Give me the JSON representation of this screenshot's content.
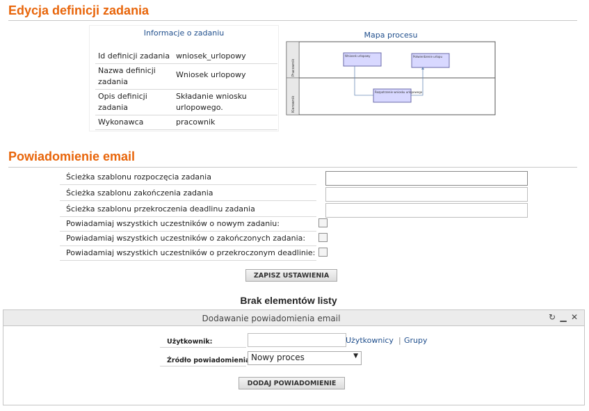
{
  "page": {
    "title": "Edycja definicji zadania"
  },
  "task_info": {
    "header": "Informacje o zadaniu",
    "rows": [
      {
        "key": "Id definicji zadania",
        "value": "wniosek_urlopowy"
      },
      {
        "key": "Nazwa definicji zadania",
        "value": "Wniosek urlopowy"
      },
      {
        "key": "Opis definicji zadania",
        "value": "Składanie wniosku urlopowego."
      },
      {
        "key": "Wykonawca",
        "value": "pracownik"
      }
    ]
  },
  "process_map": {
    "header": "Mapa procesu",
    "lane_top": "Pracownik",
    "lane_bottom": "Kierownik",
    "node_a": "Wniosek urlopowy",
    "node_b": "Potwierdzenie urlopu",
    "node_c": "Rozpatrzenie wniosku urlopowego"
  },
  "email_section": {
    "title": "Powiadomienie email",
    "fields": [
      {
        "label": "Ścieżka szablonu rozpoczęcia zadania",
        "value": ""
      },
      {
        "label": "Ścieżka szablonu zakończenia zadania",
        "value": ""
      },
      {
        "label": "Ścieżka szablonu przekroczenia deadlinu zadania",
        "value": ""
      }
    ],
    "checkboxes": [
      {
        "label": "Powiadamiaj wszystkich uczestników o nowym zadaniu:",
        "checked": false
      },
      {
        "label": "Powiadamiaj wszystkich uczestników o zakończonych zadania:",
        "checked": false
      },
      {
        "label": "Powiadamiaj wszystkich uczestników o przekroczonym deadlinie:",
        "checked": false
      }
    ],
    "save_button": "ZAPISZ USTAWIENIA"
  },
  "list": {
    "empty_message": "Brak elementów listy"
  },
  "add_panel": {
    "title": "Dodawanie powiadomienia email",
    "tools": {
      "refresh": "refresh-icon",
      "minimize": "minimize-icon",
      "close": "close-icon"
    },
    "user_label": "Użytkownik:",
    "user_value": "",
    "link_users": "Użytkownicy",
    "link_sep": "|",
    "link_groups": "Grupy",
    "source_label": "Źródło powiadomienia:",
    "source_selected": "Nowy proces",
    "add_button": "DODAJ POWIADOMIENIE"
  }
}
